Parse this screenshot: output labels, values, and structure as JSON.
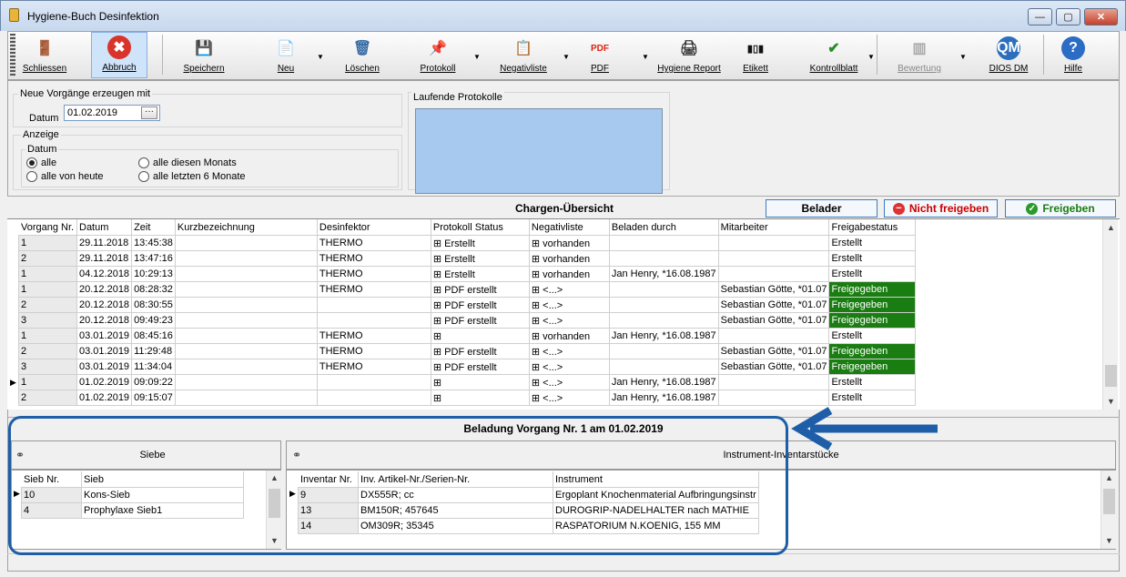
{
  "window": {
    "title": "Hygiene-Buch Desinfektion",
    "min": "—",
    "max": "▢",
    "close": "✕"
  },
  "toolbar": [
    {
      "key": "schliessen",
      "label": "Schliessen",
      "icon": "door-exit-icon",
      "glyph": "🚪",
      "color": "#8b5a2b"
    },
    {
      "key": "abbruch",
      "label": "Abbruch",
      "icon": "cancel-icon",
      "glyph": "✖",
      "color": "#ffffff",
      "bg": "#d9342b"
    },
    {
      "key": "speichern",
      "label": "Speichern",
      "icon": "save-icon",
      "glyph": "💾",
      "color": "#2b5fb3"
    },
    {
      "key": "neu",
      "label": "Neu",
      "icon": "new-document-icon",
      "glyph": "📄",
      "color": "#555"
    },
    {
      "key": "loeschen",
      "label": "Löschen",
      "icon": "trash-icon",
      "glyph": "🗑",
      "color": "#3a6ea5"
    },
    {
      "key": "protokoll",
      "label": "Protokoll",
      "icon": "protocol-icon",
      "glyph": "📌",
      "color": "#c00"
    },
    {
      "key": "negativliste",
      "label": "Negativliste",
      "icon": "clipboard-icon",
      "glyph": "📋",
      "color": "#a33"
    },
    {
      "key": "pdf",
      "label": "PDF",
      "icon": "pdf-icon",
      "glyph": "PDF",
      "color": "#d21"
    },
    {
      "key": "hygiene_report",
      "label": "Hygiene Report",
      "icon": "printer-icon",
      "glyph": "🖨",
      "color": "#333"
    },
    {
      "key": "etikett",
      "label": "Etikett",
      "icon": "barcode-icon",
      "glyph": "▮▯▮",
      "color": "#111"
    },
    {
      "key": "kontrollblatt",
      "label": "Kontrollblatt",
      "icon": "checklist-icon",
      "glyph": "✔",
      "color": "#2a8a2a"
    },
    {
      "key": "bewertung",
      "label": "Bewertung",
      "icon": "rating-icon",
      "glyph": "▥",
      "color": "#aaa"
    },
    {
      "key": "dios_dm",
      "label": "DIOS DM",
      "icon": "dios-dm-icon",
      "glyph": "QM",
      "color": "#fff",
      "bg": "#2d6fbd"
    },
    {
      "key": "hilfe",
      "label": "Hilfe",
      "icon": "help-icon",
      "glyph": "?",
      "color": "#fff",
      "bg": "#2b6cc4"
    }
  ],
  "neue": {
    "title": "Neue Vorgänge erzeugen mit",
    "datum_label": "Datum",
    "datum_value": "01.02.2019",
    "picker": "···"
  },
  "anzeige": {
    "title": "Anzeige",
    "group": "Datum",
    "opt1": "alle",
    "opt2": "alle diesen Monats",
    "opt3": "alle von heute",
    "opt4": "alle letzten 6 Monate"
  },
  "laufende": {
    "title": "Laufende Protokolle"
  },
  "chargen": {
    "title": "Chargen-Übersicht",
    "belader": "Belader",
    "nicht": "Nicht freigeben",
    "freigeben": "Freigeben",
    "colors": {
      "green": "#1a7d12"
    },
    "columns": [
      "Vorgang Nr.",
      "Datum",
      "Zeit",
      "Kurzbezeichnung",
      "Desinfektor",
      "Protokoll Status",
      "Negativliste",
      "Beladen durch",
      "Mitarbeiter",
      "Freigabestatus"
    ],
    "rows": [
      [
        "1",
        "29.11.2018",
        "13:45:38",
        "",
        "THERMO",
        "⊞ Erstellt",
        "⊞ vorhanden",
        "",
        "",
        "Erstellt"
      ],
      [
        "2",
        "29.11.2018",
        "13:47:16",
        "",
        "THERMO",
        "⊞ Erstellt",
        "⊞ vorhanden",
        "",
        "",
        "Erstellt"
      ],
      [
        "1",
        "04.12.2018",
        "10:29:13",
        "",
        "THERMO",
        "⊞ Erstellt",
        "⊞ vorhanden",
        "Jan Henry, *16.08.1987",
        "",
        "Erstellt"
      ],
      [
        "1",
        "20.12.2018",
        "08:28:32",
        "",
        "THERMO",
        "⊞ PDF erstellt",
        "⊞ <...>",
        "",
        "Sebastian Götte, *01.07",
        "Freigegeben"
      ],
      [
        "2",
        "20.12.2018",
        "08:30:55",
        "",
        "",
        "⊞ PDF erstellt",
        "⊞ <...>",
        "",
        "Sebastian Götte, *01.07",
        "Freigegeben"
      ],
      [
        "3",
        "20.12.2018",
        "09:49:23",
        "",
        "",
        "⊞ PDF erstellt",
        "⊞ <...>",
        "",
        "Sebastian Götte, *01.07",
        "Freigegeben"
      ],
      [
        "1",
        "03.01.2019",
        "08:45:16",
        "",
        "THERMO",
        "⊞",
        "⊞ vorhanden",
        "Jan Henry, *16.08.1987",
        "",
        "Erstellt"
      ],
      [
        "2",
        "03.01.2019",
        "11:29:48",
        "",
        "THERMO",
        "⊞ PDF erstellt",
        "⊞ <...>",
        "",
        "Sebastian Götte, *01.07",
        "Freigegeben"
      ],
      [
        "3",
        "03.01.2019",
        "11:34:04",
        "",
        "THERMO",
        "⊞ PDF erstellt",
        "⊞ <...>",
        "",
        "Sebastian Götte, *01.07",
        "Freigegeben"
      ],
      [
        "1",
        "01.02.2019",
        "09:09:22",
        "",
        "",
        "⊞",
        "⊞ <...>",
        "Jan Henry, *16.08.1987",
        "",
        "Erstellt"
      ],
      [
        "2",
        "01.02.2019",
        "09:15:07",
        "",
        "",
        "⊞",
        "⊞ <...>",
        "Jan Henry, *16.08.1987",
        "",
        "Erstellt"
      ]
    ]
  },
  "beladung": {
    "title": "Beladung Vorgang Nr. 1 am 01.02.2019"
  },
  "siebe": {
    "title": "Siebe",
    "columns": [
      "Sieb Nr.",
      "Sieb"
    ],
    "rows": [
      [
        "10",
        "Kons-Sieb"
      ],
      [
        "4",
        "Prophylaxe Sieb1"
      ]
    ]
  },
  "instrumente": {
    "title": "Instrument-Inventarstücke",
    "columns": [
      "Inventar Nr.",
      "Inv. Artikel-Nr./Serien-Nr.",
      "Instrument"
    ],
    "rows": [
      [
        "9",
        "DX555R; cc",
        "Ergoplant Knochenmaterial Aufbringungsinstr"
      ],
      [
        "13",
        "BM150R; 457645",
        "DUROGRIP-NADELHALTER nach MATHIE"
      ],
      [
        "14",
        "OM309R; 35345",
        "RASPATORIUM N.KOENIG, 155 MM"
      ]
    ]
  }
}
